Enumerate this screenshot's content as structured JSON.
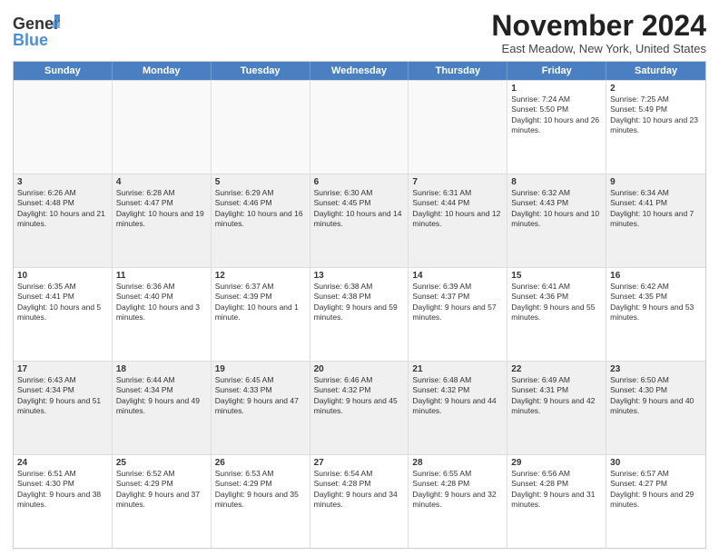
{
  "header": {
    "logo_general": "General",
    "logo_blue": "Blue",
    "month_title": "November 2024",
    "location": "East Meadow, New York, United States"
  },
  "calendar": {
    "days_of_week": [
      "Sunday",
      "Monday",
      "Tuesday",
      "Wednesday",
      "Thursday",
      "Friday",
      "Saturday"
    ],
    "rows": [
      [
        {
          "day": "",
          "info": ""
        },
        {
          "day": "",
          "info": ""
        },
        {
          "day": "",
          "info": ""
        },
        {
          "day": "",
          "info": ""
        },
        {
          "day": "",
          "info": ""
        },
        {
          "day": "1",
          "info": "Sunrise: 7:24 AM\nSunset: 5:50 PM\nDaylight: 10 hours and 26 minutes."
        },
        {
          "day": "2",
          "info": "Sunrise: 7:25 AM\nSunset: 5:49 PM\nDaylight: 10 hours and 23 minutes."
        }
      ],
      [
        {
          "day": "3",
          "info": "Sunrise: 6:26 AM\nSunset: 4:48 PM\nDaylight: 10 hours and 21 minutes."
        },
        {
          "day": "4",
          "info": "Sunrise: 6:28 AM\nSunset: 4:47 PM\nDaylight: 10 hours and 19 minutes."
        },
        {
          "day": "5",
          "info": "Sunrise: 6:29 AM\nSunset: 4:46 PM\nDaylight: 10 hours and 16 minutes."
        },
        {
          "day": "6",
          "info": "Sunrise: 6:30 AM\nSunset: 4:45 PM\nDaylight: 10 hours and 14 minutes."
        },
        {
          "day": "7",
          "info": "Sunrise: 6:31 AM\nSunset: 4:44 PM\nDaylight: 10 hours and 12 minutes."
        },
        {
          "day": "8",
          "info": "Sunrise: 6:32 AM\nSunset: 4:43 PM\nDaylight: 10 hours and 10 minutes."
        },
        {
          "day": "9",
          "info": "Sunrise: 6:34 AM\nSunset: 4:41 PM\nDaylight: 10 hours and 7 minutes."
        }
      ],
      [
        {
          "day": "10",
          "info": "Sunrise: 6:35 AM\nSunset: 4:41 PM\nDaylight: 10 hours and 5 minutes."
        },
        {
          "day": "11",
          "info": "Sunrise: 6:36 AM\nSunset: 4:40 PM\nDaylight: 10 hours and 3 minutes."
        },
        {
          "day": "12",
          "info": "Sunrise: 6:37 AM\nSunset: 4:39 PM\nDaylight: 10 hours and 1 minute."
        },
        {
          "day": "13",
          "info": "Sunrise: 6:38 AM\nSunset: 4:38 PM\nDaylight: 9 hours and 59 minutes."
        },
        {
          "day": "14",
          "info": "Sunrise: 6:39 AM\nSunset: 4:37 PM\nDaylight: 9 hours and 57 minutes."
        },
        {
          "day": "15",
          "info": "Sunrise: 6:41 AM\nSunset: 4:36 PM\nDaylight: 9 hours and 55 minutes."
        },
        {
          "day": "16",
          "info": "Sunrise: 6:42 AM\nSunset: 4:35 PM\nDaylight: 9 hours and 53 minutes."
        }
      ],
      [
        {
          "day": "17",
          "info": "Sunrise: 6:43 AM\nSunset: 4:34 PM\nDaylight: 9 hours and 51 minutes."
        },
        {
          "day": "18",
          "info": "Sunrise: 6:44 AM\nSunset: 4:34 PM\nDaylight: 9 hours and 49 minutes."
        },
        {
          "day": "19",
          "info": "Sunrise: 6:45 AM\nSunset: 4:33 PM\nDaylight: 9 hours and 47 minutes."
        },
        {
          "day": "20",
          "info": "Sunrise: 6:46 AM\nSunset: 4:32 PM\nDaylight: 9 hours and 45 minutes."
        },
        {
          "day": "21",
          "info": "Sunrise: 6:48 AM\nSunset: 4:32 PM\nDaylight: 9 hours and 44 minutes."
        },
        {
          "day": "22",
          "info": "Sunrise: 6:49 AM\nSunset: 4:31 PM\nDaylight: 9 hours and 42 minutes."
        },
        {
          "day": "23",
          "info": "Sunrise: 6:50 AM\nSunset: 4:30 PM\nDaylight: 9 hours and 40 minutes."
        }
      ],
      [
        {
          "day": "24",
          "info": "Sunrise: 6:51 AM\nSunset: 4:30 PM\nDaylight: 9 hours and 38 minutes."
        },
        {
          "day": "25",
          "info": "Sunrise: 6:52 AM\nSunset: 4:29 PM\nDaylight: 9 hours and 37 minutes."
        },
        {
          "day": "26",
          "info": "Sunrise: 6:53 AM\nSunset: 4:29 PM\nDaylight: 9 hours and 35 minutes."
        },
        {
          "day": "27",
          "info": "Sunrise: 6:54 AM\nSunset: 4:28 PM\nDaylight: 9 hours and 34 minutes."
        },
        {
          "day": "28",
          "info": "Sunrise: 6:55 AM\nSunset: 4:28 PM\nDaylight: 9 hours and 32 minutes."
        },
        {
          "day": "29",
          "info": "Sunrise: 6:56 AM\nSunset: 4:28 PM\nDaylight: 9 hours and 31 minutes."
        },
        {
          "day": "30",
          "info": "Sunrise: 6:57 AM\nSunset: 4:27 PM\nDaylight: 9 hours and 29 minutes."
        }
      ]
    ]
  }
}
